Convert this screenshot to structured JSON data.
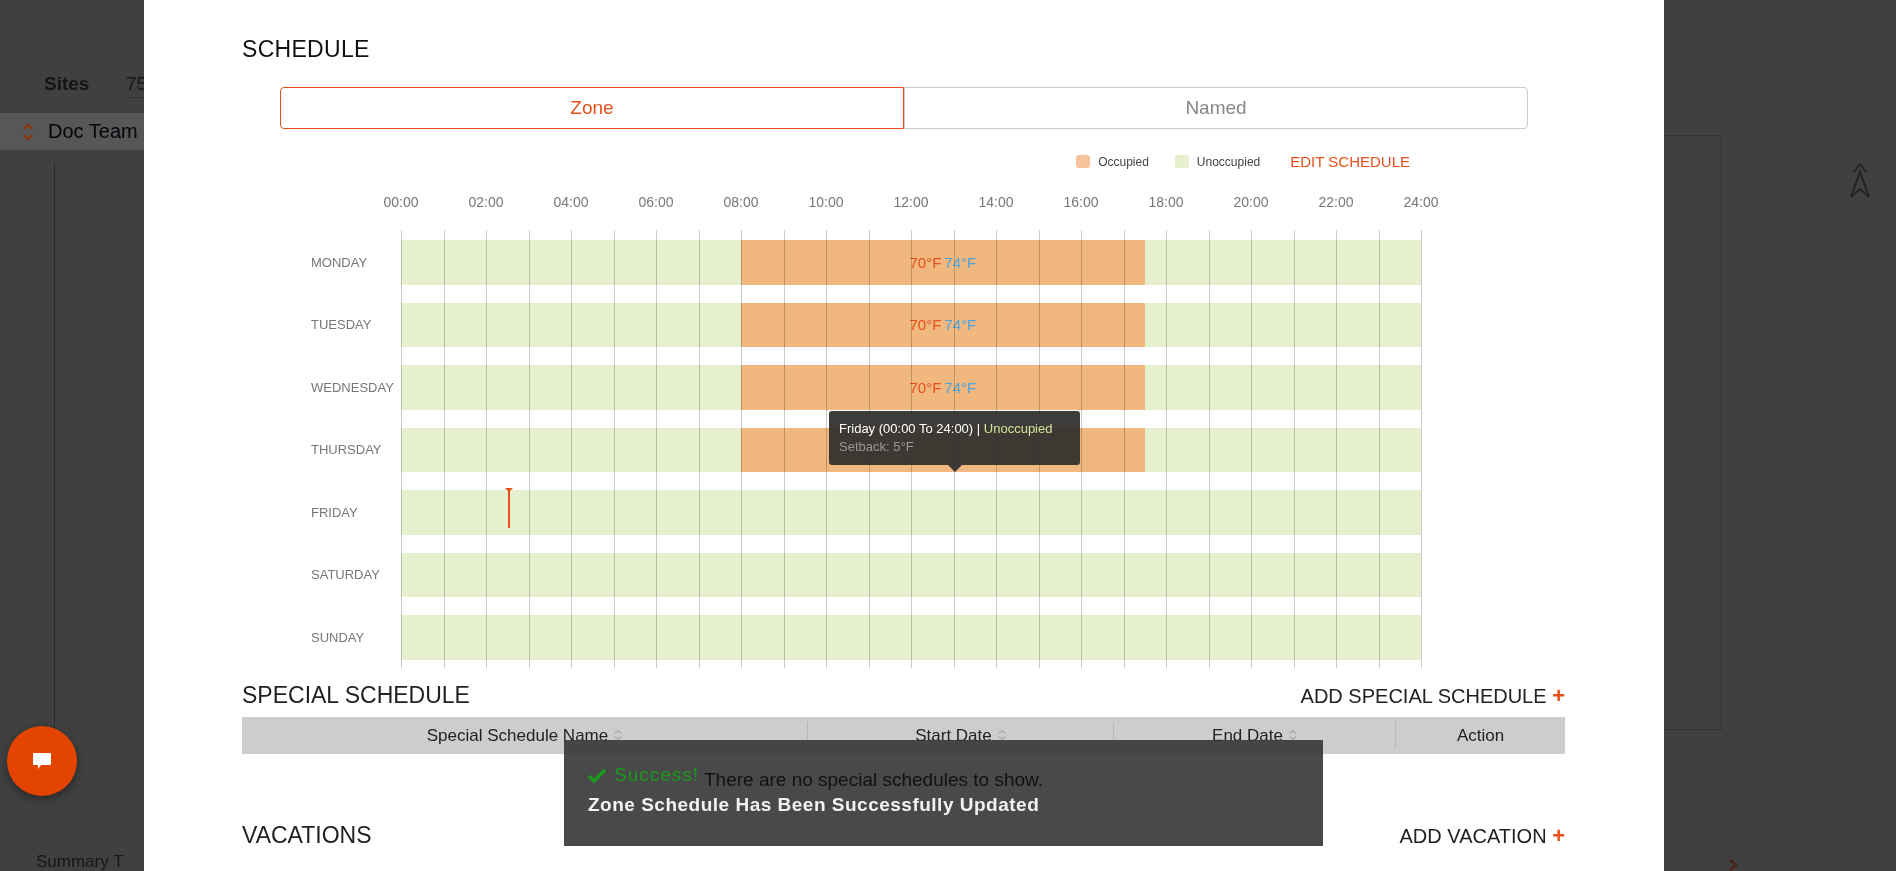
{
  "background": {
    "sites_label": "Sites",
    "sites_value": "75",
    "team_name": "Doc Team",
    "summary_label": "Summary T"
  },
  "schedule": {
    "title": "SCHEDULE",
    "tabs": [
      {
        "label": "Zone",
        "selected": true
      },
      {
        "label": "Named",
        "selected": false
      }
    ],
    "legend": [
      {
        "label": "Occupied",
        "color": "#f8c39a"
      },
      {
        "label": "Unoccupied",
        "color": "#e6f0cf"
      }
    ],
    "edit_link": "EDIT SCHEDULE",
    "times": [
      "00:00",
      "02:00",
      "04:00",
      "06:00",
      "08:00",
      "10:00",
      "12:00",
      "14:00",
      "16:00",
      "18:00",
      "20:00",
      "22:00",
      "24:00"
    ],
    "days": [
      {
        "label": "MONDAY",
        "occupied_start": {
          "level": 0.3333
        },
        "occupied_end": {
          "level": 0.7292,
          "heat": "70°F",
          "cool": "74°F"
        }
      },
      {
        "label": "TUESDAY",
        "occupied_start": {
          "level": 0.3333
        },
        "occupied_end": {
          "level": 0.7292,
          "heat": "70°F",
          "cool": "74°F"
        }
      },
      {
        "label": "WEDNESDAY",
        "occupied_start": {
          "level": 0.3333
        },
        "occupied_end": {
          "level": 0.7292,
          "heat": "70°F",
          "cool": "74°F"
        }
      },
      {
        "label": "THURSDAY",
        "occupied_start": {
          "level": 0.3333
        },
        "occupied_end": {
          "level": 0.7292
        }
      },
      {
        "label": "FRIDAY",
        "now_marker": {
          "level": 0.1055
        }
      },
      {
        "label": "SATURDAY"
      },
      {
        "label": "SUNDAY"
      }
    ],
    "tooltip": {
      "title": "Friday (00:00 To 24:00) |",
      "status": "Unoccupied",
      "detail": "Setback: 5°F"
    }
  },
  "special_schedule": {
    "title": "SPECIAL SCHEDULE",
    "add_link": "ADD SPECIAL SCHEDULE",
    "add_icon": "+",
    "columns": [
      {
        "label": "Special Schedule Name",
        "sortable": true
      },
      {
        "label": "Start Date",
        "sortable": true
      },
      {
        "label": "End Date",
        "sortable": true
      },
      {
        "label": "Action",
        "sortable": false
      }
    ],
    "empty_message": "There are no special schedules to show."
  },
  "vacations": {
    "title": "VACATIONS",
    "add_link": "ADD VACATION",
    "add_icon": "+"
  },
  "toast": {
    "status": "Success!",
    "message": "Zone Schedule Has Been Successfully Updated"
  }
}
